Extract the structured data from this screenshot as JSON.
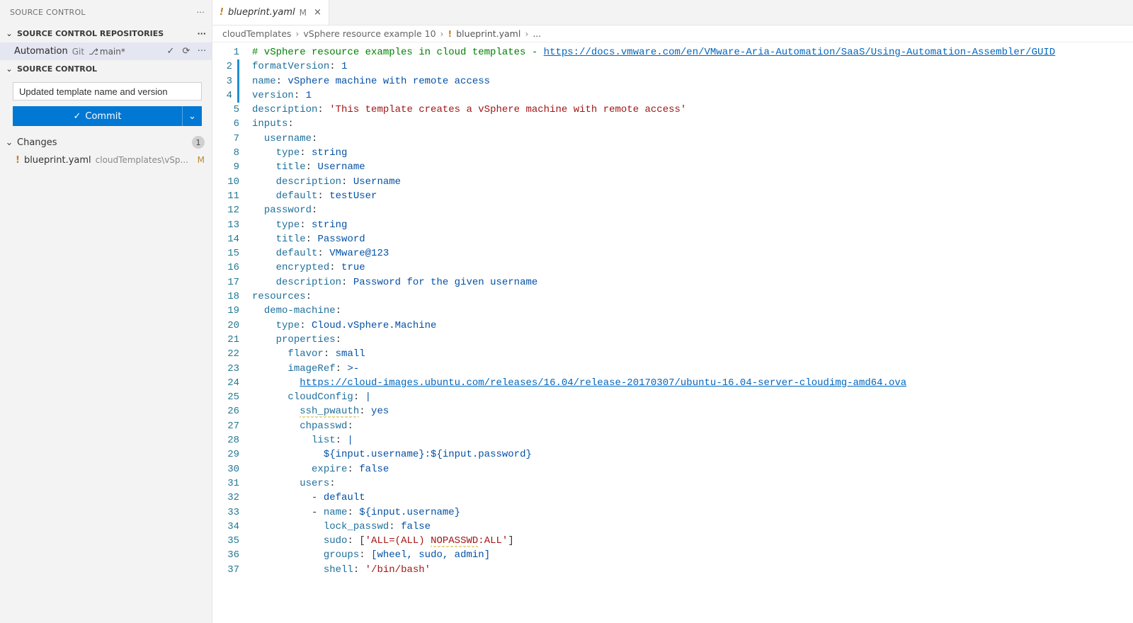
{
  "panel": {
    "title": "SOURCE CONTROL"
  },
  "repos_section": "SOURCE CONTROL REPOSITORIES",
  "repo": {
    "name": "Automation",
    "scm": "Git",
    "branch": "main*"
  },
  "scm_section": "SOURCE CONTROL",
  "commit": {
    "message": "Updated template name and version",
    "button": "Commit"
  },
  "changes": {
    "label": "Changes",
    "count": "1",
    "file": "blueprint.yaml",
    "path": "cloudTemplates\\vSp...",
    "status": "M"
  },
  "tab": {
    "file": "blueprint.yaml",
    "status": "M"
  },
  "breadcrumb": {
    "p1": "cloudTemplates",
    "p2": "vSphere resource example 10",
    "p3": "blueprint.yaml",
    "p4": "..."
  },
  "code": {
    "l1_cmt": "# vSphere resource examples in cloud templates - ",
    "l1_url": "https://docs.vmware.com/en/VMware-Aria-Automation/SaaS/Using-Automation-Assembler/GUID",
    "l2_k": "formatVersion",
    "l2_v": "1",
    "l3_k": "name",
    "l3_v": "vSphere machine with remote access",
    "l4_k": "version",
    "l4_v": "1",
    "l5_k": "description",
    "l5_v": "'This template creates a vSphere machine with remote access'",
    "l6_k": "inputs",
    "l7_k": "username",
    "l8_k": "type",
    "l8_v": "string",
    "l9_k": "title",
    "l9_v": "Username",
    "l10_k": "description",
    "l10_v": "Username",
    "l11_k": "default",
    "l11_v": "testUser",
    "l12_k": "password",
    "l13_k": "type",
    "l13_v": "string",
    "l14_k": "title",
    "l14_v": "Password",
    "l15_k": "default",
    "l15_v": "VMware@123",
    "l16_k": "encrypted",
    "l16_v": "true",
    "l17_k": "description",
    "l17_v": "Password for the given username",
    "l18_k": "resources",
    "l19_k": "demo-machine",
    "l20_k": "type",
    "l20_v": "Cloud.vSphere.Machine",
    "l21_k": "properties",
    "l22_k": "flavor",
    "l22_v": "small",
    "l23_k": "imageRef",
    "l23_v": ">-",
    "l24_url": "https://cloud-images.ubuntu.com/releases/16.04/release-20170307/ubuntu-16.04-server-cloudimg-amd64.ova",
    "l25_k": "cloudConfig",
    "l25_v": "|",
    "l26_k": "ssh_pwauth",
    "l26_v": "yes",
    "l27_k": "chpasswd",
    "l28_k": "list",
    "l28_v": "|",
    "l29_v": "${input.username}:${input.password}",
    "l30_k": "expire",
    "l30_v": "false",
    "l31_k": "users",
    "l32_v": "- default",
    "l33_pre": "- ",
    "l33_k": "name",
    "l33_v": "${input.username}",
    "l34_k": "lock_passwd",
    "l34_v": "false",
    "l35_k": "sudo",
    "l35_b1": "[",
    "l35_s": "'ALL=(ALL) ",
    "l35_np": "NOPASSWD",
    "l35_s2": ":ALL'",
    "l35_b2": "]",
    "l36_k": "groups",
    "l36_v": "[wheel, sudo, admin]",
    "l37_k": "shell",
    "l37_v": "'/bin/bash'"
  },
  "modified_lines": [
    2,
    3,
    4
  ],
  "total_lines": 37
}
